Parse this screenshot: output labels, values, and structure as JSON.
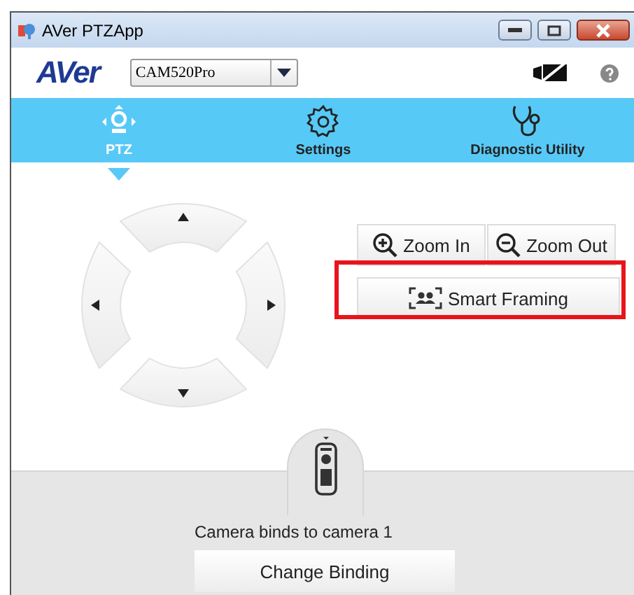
{
  "window": {
    "title": "AVer PTZApp"
  },
  "header": {
    "logo": "AVer",
    "camera_select": {
      "value": "CAM520Pro"
    },
    "camera_disabled": true
  },
  "tabs": [
    {
      "label": "PTZ",
      "kind": "ptz",
      "selected": true
    },
    {
      "label": "Settings",
      "kind": "settings",
      "selected": false
    },
    {
      "label": "Diagnostic Utility",
      "kind": "diagnostic",
      "selected": false
    }
  ],
  "zoom_buttons": [
    {
      "label": "Zoom In",
      "kind": "in"
    },
    {
      "label": "Zoom Out",
      "kind": "out"
    }
  ],
  "smart_framing": {
    "label": "Smart Framing",
    "highlighted": true
  },
  "binding": {
    "status": "Camera binds to camera 1",
    "button": "Change Binding"
  }
}
